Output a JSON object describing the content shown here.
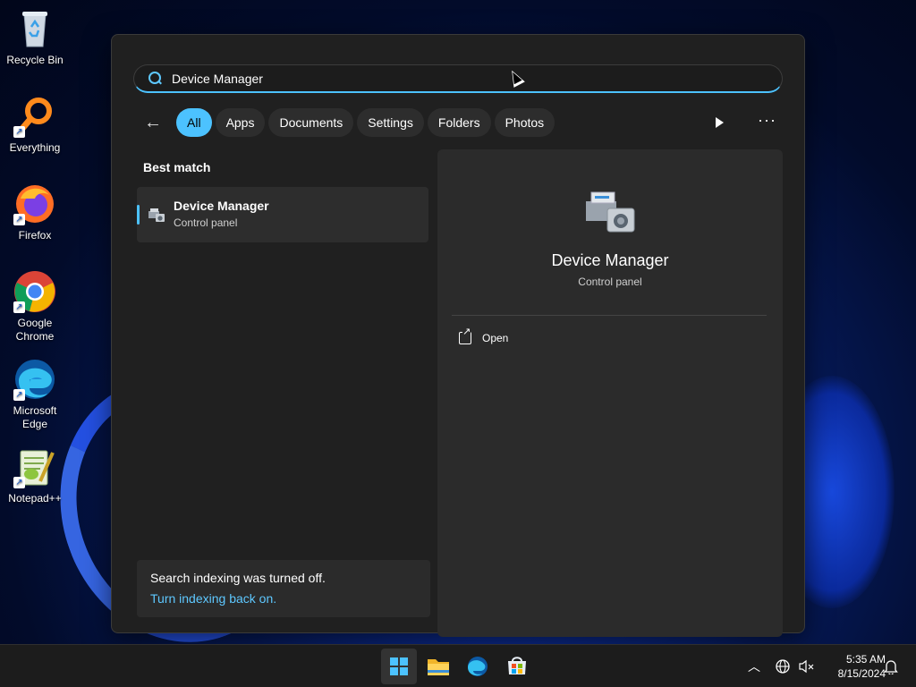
{
  "desktop": {
    "icons": [
      {
        "label": "Recycle Bin",
        "icon": "recycle-bin-icon"
      },
      {
        "label": "Everything",
        "icon": "everything-search-icon"
      },
      {
        "label": "Firefox",
        "icon": "firefox-icon"
      },
      {
        "label": "Google Chrome",
        "icon": "chrome-icon"
      },
      {
        "label": "Microsoft Edge",
        "icon": "edge-icon"
      },
      {
        "label": "Notepad++",
        "icon": "notepad-plus-plus-icon"
      }
    ]
  },
  "search": {
    "query": "Device Manager",
    "filters": [
      "All",
      "Apps",
      "Documents",
      "Settings",
      "Folders",
      "Photos"
    ],
    "active_filter": "All"
  },
  "results": {
    "best_match_label": "Best match",
    "best_match": {
      "title": "Device Manager",
      "subtitle": "Control panel"
    }
  },
  "indexing": {
    "message": "Search indexing was turned off.",
    "link": "Turn indexing back on."
  },
  "preview": {
    "title": "Device Manager",
    "subtitle": "Control panel",
    "actions": [
      {
        "label": "Open",
        "icon": "open-external-icon"
      }
    ]
  },
  "taskbar": {
    "apps": [
      "start-button",
      "file-explorer",
      "edge",
      "microsoft-store"
    ],
    "time": "5:35 AM",
    "date": "8/15/2024"
  },
  "colors": {
    "accent": "#4cc2ff",
    "panel": "#202020",
    "taskbar": "#1c1c1c"
  }
}
